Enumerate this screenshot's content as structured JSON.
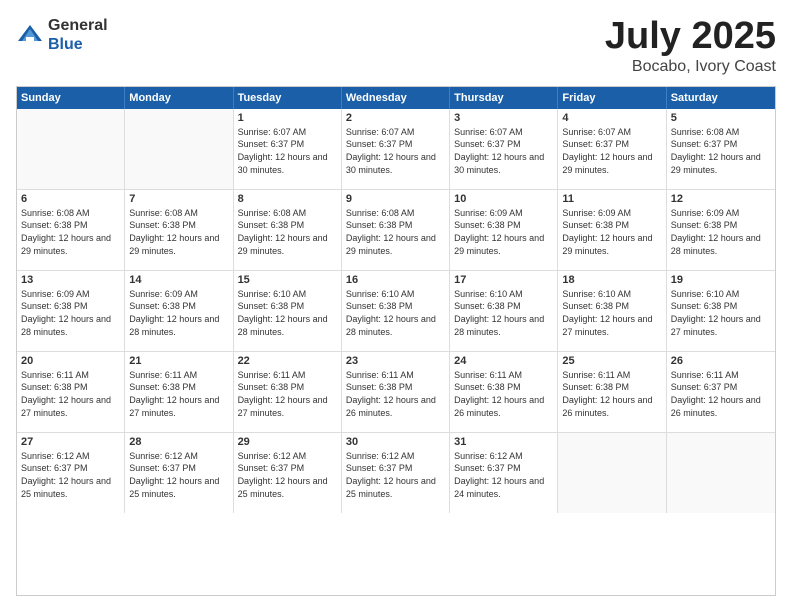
{
  "logo": {
    "general": "General",
    "blue": "Blue"
  },
  "header": {
    "month": "July 2025",
    "location": "Bocabo, Ivory Coast"
  },
  "weekdays": [
    "Sunday",
    "Monday",
    "Tuesday",
    "Wednesday",
    "Thursday",
    "Friday",
    "Saturday"
  ],
  "weeks": [
    [
      {
        "day": "",
        "empty": true
      },
      {
        "day": "",
        "empty": true
      },
      {
        "day": "1",
        "sunrise": "Sunrise: 6:07 AM",
        "sunset": "Sunset: 6:37 PM",
        "daylight": "Daylight: 12 hours and 30 minutes."
      },
      {
        "day": "2",
        "sunrise": "Sunrise: 6:07 AM",
        "sunset": "Sunset: 6:37 PM",
        "daylight": "Daylight: 12 hours and 30 minutes."
      },
      {
        "day": "3",
        "sunrise": "Sunrise: 6:07 AM",
        "sunset": "Sunset: 6:37 PM",
        "daylight": "Daylight: 12 hours and 30 minutes."
      },
      {
        "day": "4",
        "sunrise": "Sunrise: 6:07 AM",
        "sunset": "Sunset: 6:37 PM",
        "daylight": "Daylight: 12 hours and 29 minutes."
      },
      {
        "day": "5",
        "sunrise": "Sunrise: 6:08 AM",
        "sunset": "Sunset: 6:37 PM",
        "daylight": "Daylight: 12 hours and 29 minutes."
      }
    ],
    [
      {
        "day": "6",
        "sunrise": "Sunrise: 6:08 AM",
        "sunset": "Sunset: 6:38 PM",
        "daylight": "Daylight: 12 hours and 29 minutes."
      },
      {
        "day": "7",
        "sunrise": "Sunrise: 6:08 AM",
        "sunset": "Sunset: 6:38 PM",
        "daylight": "Daylight: 12 hours and 29 minutes."
      },
      {
        "day": "8",
        "sunrise": "Sunrise: 6:08 AM",
        "sunset": "Sunset: 6:38 PM",
        "daylight": "Daylight: 12 hours and 29 minutes."
      },
      {
        "day": "9",
        "sunrise": "Sunrise: 6:08 AM",
        "sunset": "Sunset: 6:38 PM",
        "daylight": "Daylight: 12 hours and 29 minutes."
      },
      {
        "day": "10",
        "sunrise": "Sunrise: 6:09 AM",
        "sunset": "Sunset: 6:38 PM",
        "daylight": "Daylight: 12 hours and 29 minutes."
      },
      {
        "day": "11",
        "sunrise": "Sunrise: 6:09 AM",
        "sunset": "Sunset: 6:38 PM",
        "daylight": "Daylight: 12 hours and 29 minutes."
      },
      {
        "day": "12",
        "sunrise": "Sunrise: 6:09 AM",
        "sunset": "Sunset: 6:38 PM",
        "daylight": "Daylight: 12 hours and 28 minutes."
      }
    ],
    [
      {
        "day": "13",
        "sunrise": "Sunrise: 6:09 AM",
        "sunset": "Sunset: 6:38 PM",
        "daylight": "Daylight: 12 hours and 28 minutes."
      },
      {
        "day": "14",
        "sunrise": "Sunrise: 6:09 AM",
        "sunset": "Sunset: 6:38 PM",
        "daylight": "Daylight: 12 hours and 28 minutes."
      },
      {
        "day": "15",
        "sunrise": "Sunrise: 6:10 AM",
        "sunset": "Sunset: 6:38 PM",
        "daylight": "Daylight: 12 hours and 28 minutes."
      },
      {
        "day": "16",
        "sunrise": "Sunrise: 6:10 AM",
        "sunset": "Sunset: 6:38 PM",
        "daylight": "Daylight: 12 hours and 28 minutes."
      },
      {
        "day": "17",
        "sunrise": "Sunrise: 6:10 AM",
        "sunset": "Sunset: 6:38 PM",
        "daylight": "Daylight: 12 hours and 28 minutes."
      },
      {
        "day": "18",
        "sunrise": "Sunrise: 6:10 AM",
        "sunset": "Sunset: 6:38 PM",
        "daylight": "Daylight: 12 hours and 27 minutes."
      },
      {
        "day": "19",
        "sunrise": "Sunrise: 6:10 AM",
        "sunset": "Sunset: 6:38 PM",
        "daylight": "Daylight: 12 hours and 27 minutes."
      }
    ],
    [
      {
        "day": "20",
        "sunrise": "Sunrise: 6:11 AM",
        "sunset": "Sunset: 6:38 PM",
        "daylight": "Daylight: 12 hours and 27 minutes."
      },
      {
        "day": "21",
        "sunrise": "Sunrise: 6:11 AM",
        "sunset": "Sunset: 6:38 PM",
        "daylight": "Daylight: 12 hours and 27 minutes."
      },
      {
        "day": "22",
        "sunrise": "Sunrise: 6:11 AM",
        "sunset": "Sunset: 6:38 PM",
        "daylight": "Daylight: 12 hours and 27 minutes."
      },
      {
        "day": "23",
        "sunrise": "Sunrise: 6:11 AM",
        "sunset": "Sunset: 6:38 PM",
        "daylight": "Daylight: 12 hours and 26 minutes."
      },
      {
        "day": "24",
        "sunrise": "Sunrise: 6:11 AM",
        "sunset": "Sunset: 6:38 PM",
        "daylight": "Daylight: 12 hours and 26 minutes."
      },
      {
        "day": "25",
        "sunrise": "Sunrise: 6:11 AM",
        "sunset": "Sunset: 6:38 PM",
        "daylight": "Daylight: 12 hours and 26 minutes."
      },
      {
        "day": "26",
        "sunrise": "Sunrise: 6:11 AM",
        "sunset": "Sunset: 6:37 PM",
        "daylight": "Daylight: 12 hours and 26 minutes."
      }
    ],
    [
      {
        "day": "27",
        "sunrise": "Sunrise: 6:12 AM",
        "sunset": "Sunset: 6:37 PM",
        "daylight": "Daylight: 12 hours and 25 minutes."
      },
      {
        "day": "28",
        "sunrise": "Sunrise: 6:12 AM",
        "sunset": "Sunset: 6:37 PM",
        "daylight": "Daylight: 12 hours and 25 minutes."
      },
      {
        "day": "29",
        "sunrise": "Sunrise: 6:12 AM",
        "sunset": "Sunset: 6:37 PM",
        "daylight": "Daylight: 12 hours and 25 minutes."
      },
      {
        "day": "30",
        "sunrise": "Sunrise: 6:12 AM",
        "sunset": "Sunset: 6:37 PM",
        "daylight": "Daylight: 12 hours and 25 minutes."
      },
      {
        "day": "31",
        "sunrise": "Sunrise: 6:12 AM",
        "sunset": "Sunset: 6:37 PM",
        "daylight": "Daylight: 12 hours and 24 minutes."
      },
      {
        "day": "",
        "empty": true
      },
      {
        "day": "",
        "empty": true
      }
    ]
  ]
}
